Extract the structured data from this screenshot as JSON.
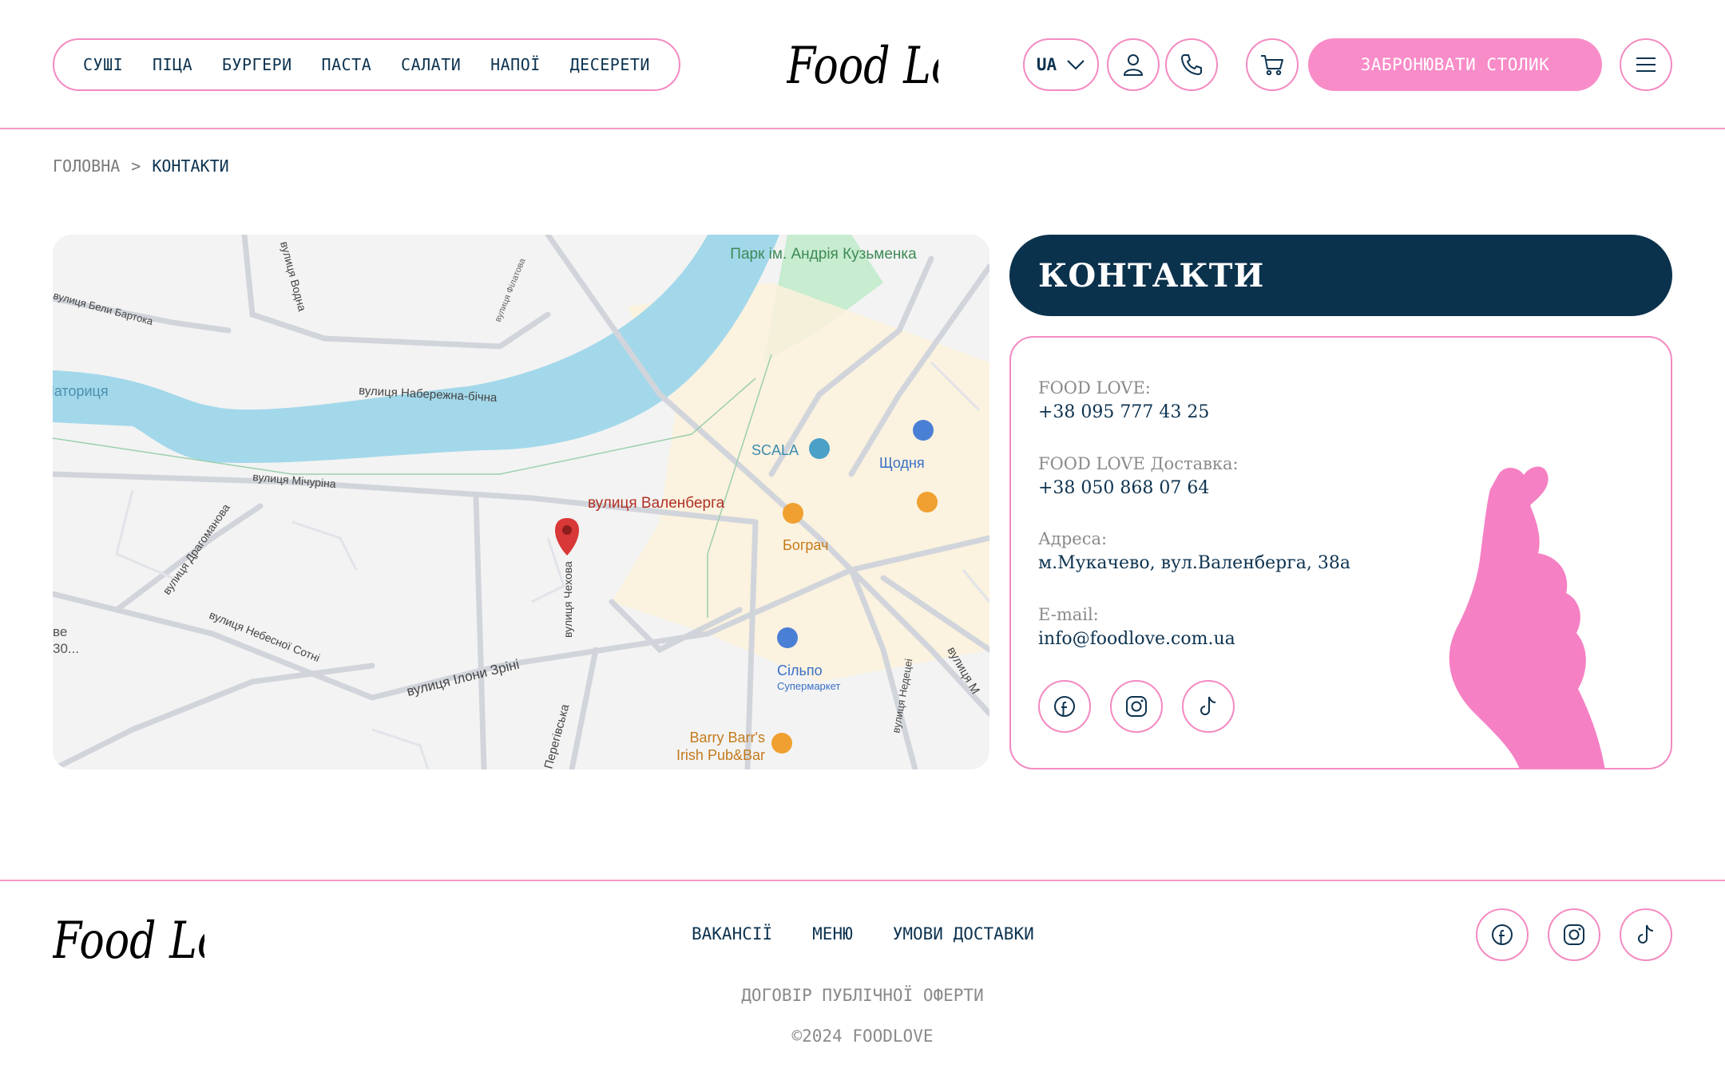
{
  "nav": {
    "items": [
      {
        "label": "СУШІ"
      },
      {
        "label": "ПІЦА"
      },
      {
        "label": "БУРГЕРИ"
      },
      {
        "label": "ПАСТА"
      },
      {
        "label": "САЛАТИ"
      },
      {
        "label": "НАПОЇ"
      },
      {
        "label": "ДЕСЕРЕТИ"
      }
    ]
  },
  "brand": {
    "logo_text": "Food Love"
  },
  "header": {
    "lang": "UA",
    "book_label": "ЗАБРОНЮВАТИ СТОЛИК",
    "icons": [
      "user-icon",
      "phone-icon",
      "cart-icon",
      "menu-icon"
    ]
  },
  "breadcrumb": {
    "home": "ГОЛОВНА",
    "sep": ">",
    "current": "КОНТАКТИ"
  },
  "map": {
    "labels": {
      "park": "Парк ім. Андрія Кузьменка",
      "street_naberezhna": "вулиця Набережна-бічна",
      "street_vodna": "вулиця Водна",
      "street_filatova": "вулиця Філатова",
      "street_barto": "вулиця Бели Бартока",
      "river": "Латориця",
      "street_michurina": "вулиця Мічуріна",
      "street_dragomanova": "вулиця Драгоманова",
      "street_nebesnoi": "вулиця Небесної Сотні",
      "street_chekhova": "вулиця Чехова",
      "street_ilony": "вулиця Ілони Зріні",
      "street_pereg": "Перегівська",
      "street_nedetsei": "вулиця Недецеі",
      "street_right": "вулиця М",
      "pin_label": "вулиця Валенберга",
      "scala": "SCALA",
      "shchodnia": "Щодня",
      "bograch": "Бограч",
      "silpo": "Сільпо",
      "silpo_sub": "Супермаркет",
      "barry": "Barry Barr's",
      "barry2": "Irish Pub&Bar",
      "left_cut1": "ве",
      "left_cut2": "30..."
    }
  },
  "contacts": {
    "title": "КОНТАКТИ",
    "items": [
      {
        "label": "FOOD LOVE:",
        "value": "+38 095 777 43 25"
      },
      {
        "label": "FOOD LOVE Доставка:",
        "value": "+38 050 868 07 64"
      },
      {
        "label": "Адреса:",
        "value": "м.Мукачево, вул.Валенберга, 38а"
      },
      {
        "label": "E-mail:",
        "value": "info@foodlove.com.ua"
      }
    ],
    "socials": [
      "facebook-icon",
      "instagram-icon",
      "tiktok-icon"
    ]
  },
  "footer": {
    "links": [
      {
        "label": "ВАКАНСІЇ"
      },
      {
        "label": "МЕНЮ"
      },
      {
        "label": "УМОВИ ДОСТАВКИ"
      }
    ],
    "offer": "ДОГОВІР ПУБЛІЧНОЇ ОФЕРТИ",
    "copyright": "©2024 FOODLOVE"
  },
  "colors": {
    "pink": "#f88cc8",
    "navy": "#0b324d",
    "river": "#a3d8ea"
  }
}
